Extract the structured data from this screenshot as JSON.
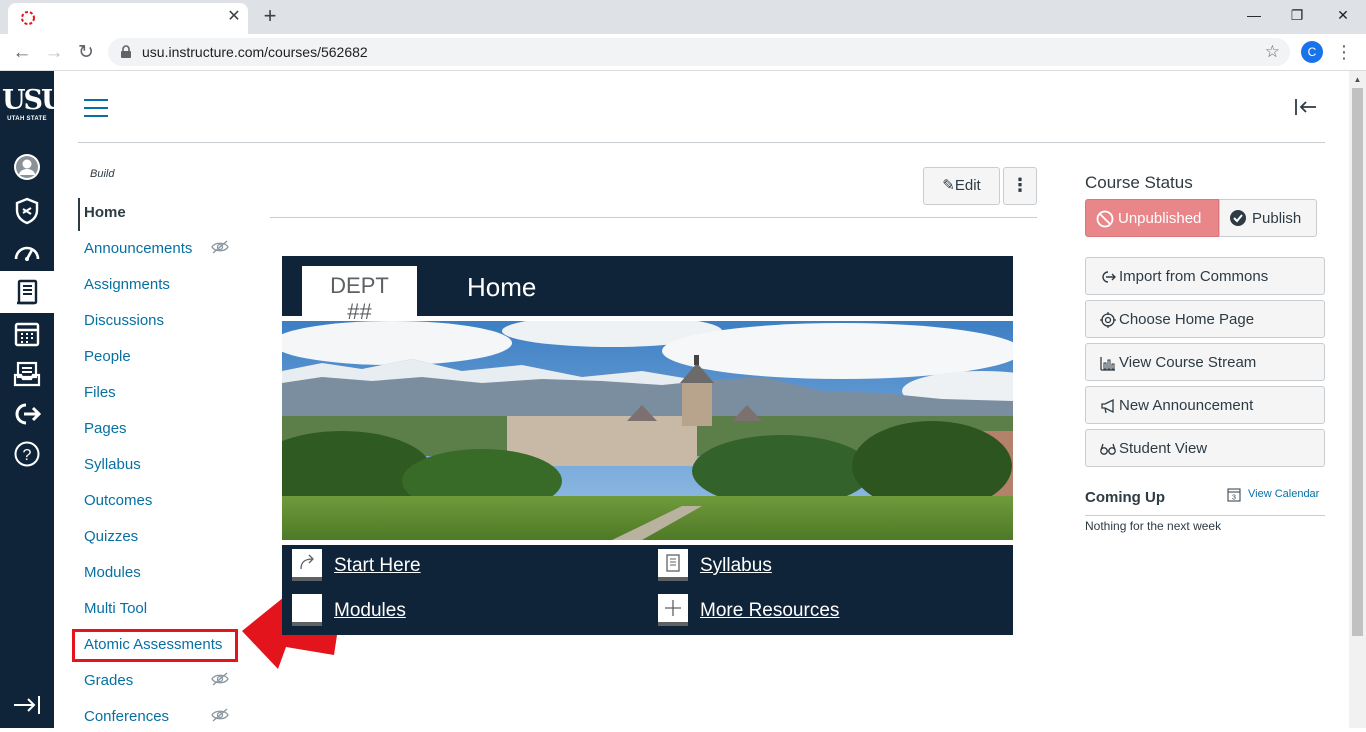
{
  "browser": {
    "tab_close": "✕",
    "new_tab": "+",
    "url": "usu.instructure.com/courses/562682",
    "profile_initial": "C",
    "window_controls": [
      "—",
      "❐",
      "✕"
    ]
  },
  "global_nav": {
    "logo_big": "USU",
    "logo_small": "UTAH STATE",
    "items": [
      "account-icon",
      "admin-icon",
      "dashboard-icon",
      "courses-icon",
      "calendar-icon",
      "inbox-icon",
      "commons-icon",
      "help-icon"
    ],
    "active": "courses-icon"
  },
  "course_nav": {
    "section_label": "Build",
    "items": [
      {
        "label": "Home",
        "active": true,
        "hidden": false
      },
      {
        "label": "Announcements",
        "hidden": true
      },
      {
        "label": "Assignments",
        "hidden": false
      },
      {
        "label": "Discussions",
        "hidden": false
      },
      {
        "label": "People",
        "hidden": false
      },
      {
        "label": "Files",
        "hidden": false
      },
      {
        "label": "Pages",
        "hidden": false
      },
      {
        "label": "Syllabus",
        "hidden": false
      },
      {
        "label": "Outcomes",
        "hidden": false
      },
      {
        "label": "Quizzes",
        "hidden": false
      },
      {
        "label": "Modules",
        "hidden": false
      },
      {
        "label": "Multi Tool",
        "hidden": false
      },
      {
        "label": "Atomic Assessments",
        "hidden": false,
        "highlighted": true
      },
      {
        "label": "Grades",
        "hidden": true
      },
      {
        "label": "Conferences",
        "hidden": true
      }
    ]
  },
  "content": {
    "edit_label": "Edit",
    "more_label": "⋮",
    "banner": {
      "dept_line1": "DEPT",
      "dept_line2": "##",
      "title": "Home"
    },
    "quick_links": [
      {
        "label": " Start Here",
        "icon": "share-arrow-icon"
      },
      {
        "label": " Syllabus",
        "icon": "syllabus-icon"
      },
      {
        "label": "Modules",
        "icon": "modules-icon"
      },
      {
        "label": " More Resources",
        "icon": "plus-icon"
      }
    ]
  },
  "sidebar": {
    "course_status": "Course Status",
    "unpublished": "Unpublished",
    "publish": "Publish",
    "buttons": [
      {
        "label": "Import from Commons",
        "icon": "commons-icon"
      },
      {
        "label": "Choose Home Page",
        "icon": "target-icon"
      },
      {
        "label": "View Course Stream",
        "icon": "stream-icon"
      },
      {
        "label": "New Announcement",
        "icon": "megaphone-icon"
      },
      {
        "label": "Student View",
        "icon": "glasses-icon"
      }
    ],
    "coming_up": "Coming Up",
    "view_calendar": "View Calendar",
    "calendar_day": "3",
    "nothing": "Nothing for the next week"
  },
  "colors": {
    "nav_bg": "#0f2439",
    "link": "#0770a3",
    "unpublished": "#e8868a",
    "highlight": "#e3141c"
  }
}
